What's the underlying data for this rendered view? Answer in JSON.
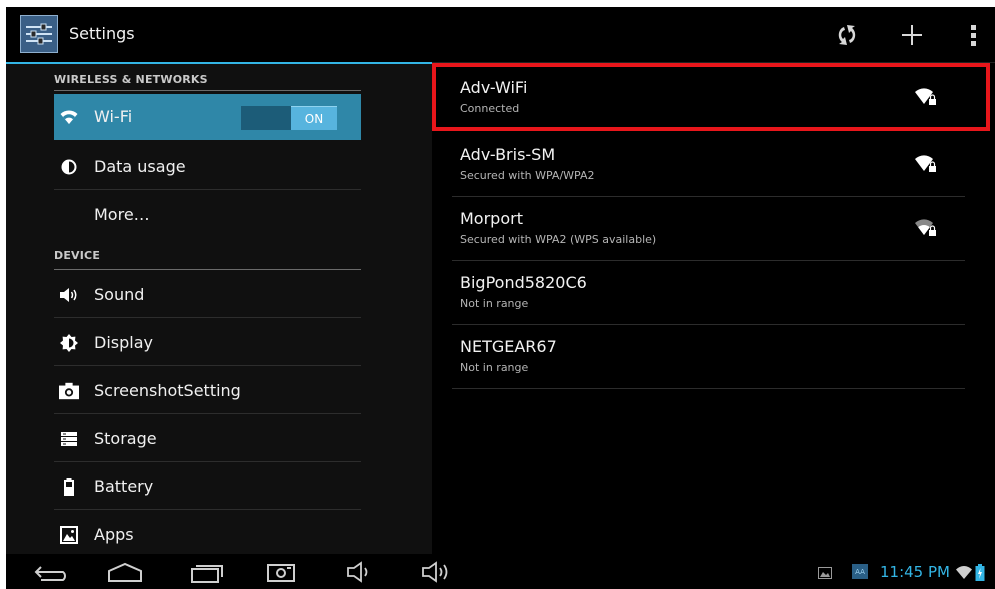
{
  "app": {
    "title": "Settings",
    "icon": "settings-sliders-icon"
  },
  "action_bar": {
    "buttons": [
      {
        "name": "wps-button",
        "icon": "wps-icon"
      },
      {
        "name": "add-network-button",
        "icon": "plus-icon"
      },
      {
        "name": "overflow-menu-button",
        "icon": "overflow-icon"
      }
    ]
  },
  "sidebar": {
    "sections": [
      {
        "header": "WIRELESS & NETWORKS"
      },
      {
        "header": "DEVICE"
      }
    ],
    "items": [
      {
        "label": "Wi-Fi",
        "icon": "wifi-icon",
        "selected": true,
        "toggle": "ON"
      },
      {
        "label": "Data usage",
        "icon": "data-usage-icon"
      },
      {
        "label": "More…",
        "icon": ""
      },
      {
        "label": "Sound",
        "icon": "speaker-icon"
      },
      {
        "label": "Display",
        "icon": "brightness-icon"
      },
      {
        "label": "ScreenshotSetting",
        "icon": "camera-icon"
      },
      {
        "label": "Storage",
        "icon": "storage-icon"
      },
      {
        "label": "Battery",
        "icon": "battery-icon"
      },
      {
        "label": "Apps",
        "icon": "apps-icon"
      }
    ]
  },
  "networks": [
    {
      "ssid": "Adv-WiFi",
      "summary": "Connected",
      "signal": "secured-wifi-icon"
    },
    {
      "ssid": "Adv-Bris-SM",
      "summary": "Secured with WPA/WPA2",
      "signal": "secured-wifi-icon"
    },
    {
      "ssid": "Morport",
      "summary": "Secured with WPA2 (WPS available)",
      "signal": "secured-wifi-icon"
    },
    {
      "ssid": "BigPond5820C6",
      "summary": "Not in range"
    },
    {
      "ssid": "NETGEAR67",
      "summary": "Not in range"
    }
  ],
  "nav_bar": {
    "buttons": [
      "back-icon",
      "home-icon",
      "recents-icon",
      "screenshot-icon",
      "volume-down-icon",
      "volume-up-icon"
    ],
    "status": {
      "time": "11:45 PM",
      "icons": [
        "gallery-icon",
        "keyboard-icon",
        "wifi-icon",
        "battery-icon"
      ]
    }
  },
  "colors": {
    "accent": "#33b5e5",
    "selected_bg": "#2f87a8",
    "highlight": "#e8161b"
  }
}
